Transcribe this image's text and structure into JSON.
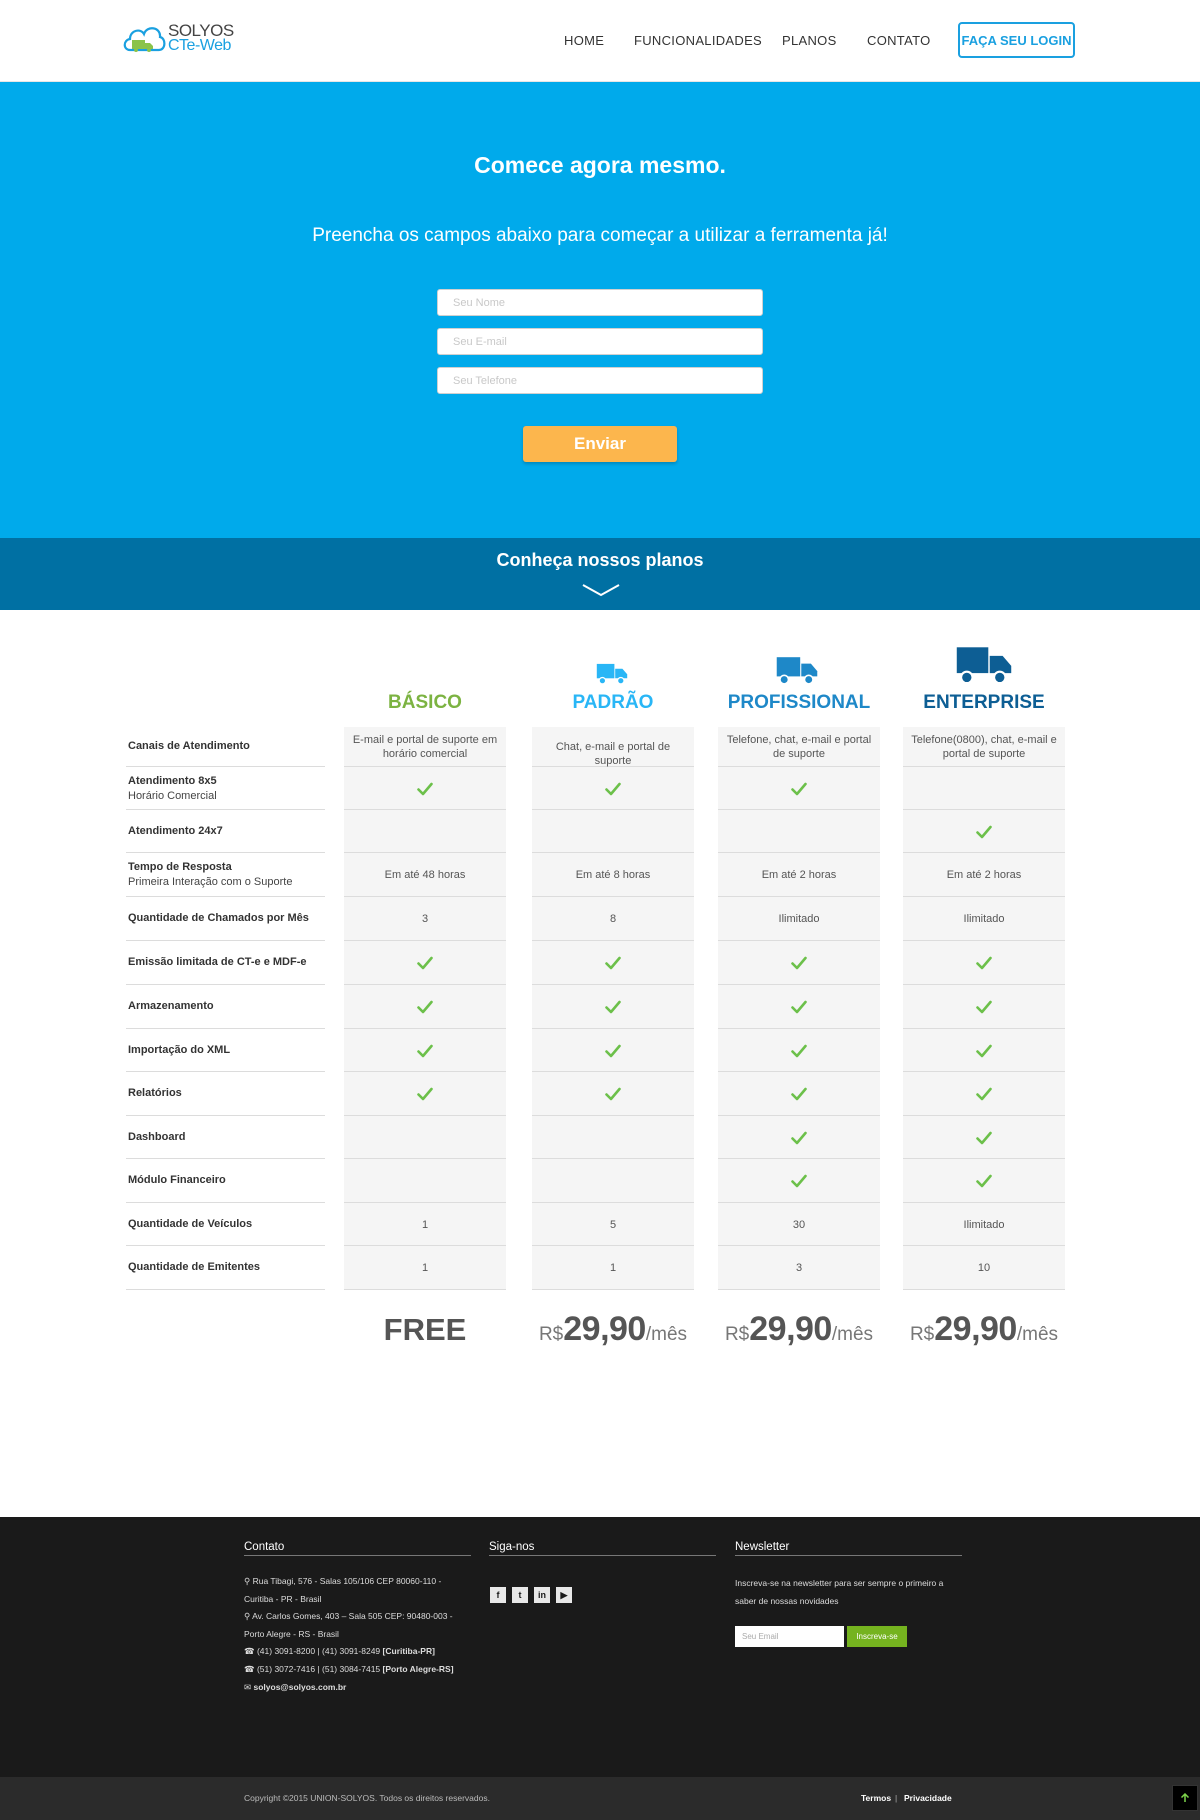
{
  "header": {
    "logo_line1": "SOLYOS",
    "logo_line2": "CTe-Web",
    "nav": [
      "HOME",
      "FUNCIONALIDADES",
      "PLANOS",
      "CONTATO"
    ],
    "login_label": "FAÇA SEU LOGIN"
  },
  "hero": {
    "title": "Comece agora mesmo.",
    "subtitle": "Preencha os campos abaixo para começar a utilizar a ferramenta já!",
    "name_placeholder": "Seu Nome",
    "email_placeholder": "Seu E-mail",
    "phone_placeholder": "Seu Telefone",
    "send_label": "Enviar"
  },
  "plans_band": {
    "title": "Conheça nossos planos"
  },
  "pricing": {
    "plans": [
      {
        "name": "BÁSICO",
        "color": "#7cb342"
      },
      {
        "name": "PADRÃO",
        "color": "#29b6f6"
      },
      {
        "name": "PROFISSIONAL",
        "color": "#1e88c8"
      },
      {
        "name": "ENTERPRISE",
        "color": "#0d5e94"
      }
    ],
    "features": [
      {
        "label": "Canais de Atendimento",
        "sub": "",
        "values": [
          "E-mail e portal de suporte em horário comercial",
          "Chat, e-mail e portal de suporte",
          "Telefone, chat, e-mail e portal de suporte",
          "Telefone(0800), chat, e-mail e portal de suporte"
        ]
      },
      {
        "label": "Atendimento 8x5",
        "sub": "Horário Comercial",
        "values": [
          "check",
          "check",
          "check",
          ""
        ]
      },
      {
        "label": "Atendimento 24x7",
        "sub": "",
        "values": [
          "",
          "",
          "",
          "check"
        ]
      },
      {
        "label": "Tempo de Resposta",
        "sub": "Primeira Interação com o Suporte",
        "values": [
          "Em até 48 horas",
          "Em até 8 horas",
          "Em até 2 horas",
          "Em até 2 horas"
        ]
      },
      {
        "label": "Quantidade de Chamados por Mês",
        "sub": "",
        "values": [
          "3",
          "8",
          "Ilimitado",
          "Ilimitado"
        ]
      },
      {
        "label": "Emissão limitada de CT-e e MDF-e",
        "sub": "",
        "values": [
          "check",
          "check",
          "check",
          "check"
        ]
      },
      {
        "label": "Armazenamento",
        "sub": "",
        "values": [
          "check",
          "check",
          "check",
          "check"
        ]
      },
      {
        "label": "Importação do XML",
        "sub": "",
        "values": [
          "check",
          "check",
          "check",
          "check"
        ]
      },
      {
        "label": "Relatórios",
        "sub": "",
        "values": [
          "check",
          "check",
          "check",
          "check"
        ]
      },
      {
        "label": "Dashboard",
        "sub": "",
        "values": [
          "",
          "",
          "check",
          "check"
        ]
      },
      {
        "label": "Módulo Financeiro",
        "sub": "",
        "values": [
          "",
          "",
          "check",
          "check"
        ]
      },
      {
        "label": "Quantidade de Veículos",
        "sub": "",
        "values": [
          "1",
          "5",
          "30",
          "Ilimitado"
        ]
      },
      {
        "label": "Quantidade de Emitentes",
        "sub": "",
        "values": [
          "1",
          "1",
          "3",
          "10"
        ]
      }
    ],
    "free_label": "FREE",
    "currency": "R$",
    "price_value": "29,90",
    "period": "/mês",
    "check_color": "#6cc04a"
  },
  "footer": {
    "contact_title": "Contato",
    "address1": "Rua Tibagi, 576 - Salas 105/106 CEP 80060-110 - Curitiba - PR - Brasil",
    "address2": "Av. Carlos Gomes, 403 – Sala 505 CEP: 90480-003 - Porto Alegre - RS - Brasil",
    "phone1": "(41) 3091-8200 | (41) 3091-8249",
    "phone1_city": "[Curitiba-PR]",
    "phone2": "(51) 3072-7416 | (51) 3084-7415",
    "phone2_city": "[Porto Alegre-RS]",
    "email": "solyos@solyos.com.br",
    "social_title": "Siga-nos",
    "newsletter_title": "Newsletter",
    "newsletter_text": "Inscreva-se na newsletter para ser sempre o primeiro a saber de nossas novidades",
    "newsletter_placeholder": "Seu Email",
    "newsletter_button": "Inscreva-se",
    "copyright": "Copyright ©2015 UNION-SOLYOS. Todos os direitos reservados.",
    "terms": "Termos",
    "privacy": "Privacidade"
  }
}
